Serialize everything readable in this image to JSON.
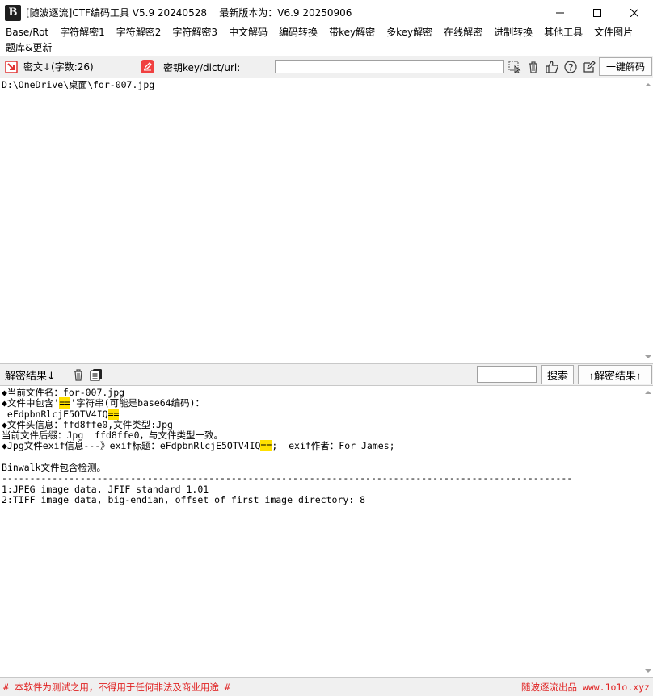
{
  "titlebar": {
    "logo_text": "B",
    "title": "[随波逐流]CTF编码工具 V5.9 20240528    最新版本为：V6.9 20250906"
  },
  "menu": {
    "row1": [
      "Base/Rot",
      "字符解密1",
      "字符解密2",
      "字符解密3",
      "中文解码",
      "编码转换",
      "带key解密",
      "多key解密",
      "在线解密",
      "进制转换",
      "其他工具",
      "文件图片"
    ],
    "row2": [
      "题库&更新"
    ]
  },
  "toolbar": {
    "cipher_label": "密文↓(字数:26)",
    "key_label": "密钥key/dict/url:",
    "key_value": "",
    "decode_button": "一键解码"
  },
  "input_pane": {
    "text": "D:\\OneDrive\\桌面\\for-007.jpg"
  },
  "result_bar": {
    "label": "解密结果↓",
    "search_value": "",
    "search_button": "搜索",
    "up_button": "↑解密结果↑"
  },
  "output_pane": {
    "lines": [
      [
        {
          "t": "◆当前文件名：for-007.jpg"
        }
      ],
      [
        {
          "t": "◆文件中包含'"
        },
        {
          "t": "==",
          "hl": true
        },
        {
          "t": "'字符串(可能是base64编码)："
        }
      ],
      [
        {
          "t": " eFdpbnRlcjE5OTV4IQ"
        },
        {
          "t": "==",
          "hl": true
        }
      ],
      [
        {
          "t": "◆文件头信息：ffd8ffe0,文件类型:Jpg"
        }
      ],
      [
        {
          "t": "当前文件后缀：Jpg  ffd8ffe0，与文件类型一致。"
        }
      ],
      [
        {
          "t": "◆Jpg文件exif信息---》exif标题：eFdpbnRlcjE5OTV4IQ"
        },
        {
          "t": "==",
          "hl": true
        },
        {
          "t": ";  exif作者：For James;"
        }
      ],
      [
        {
          "t": ""
        }
      ],
      [
        {
          "t": "Binwalk文件包含检测。"
        }
      ],
      [
        {
          "t": "------------------------------------------------------------------------------------------------------"
        }
      ],
      [
        {
          "t": "1:JPEG image data, JFIF standard 1.01"
        }
      ],
      [
        {
          "t": "2:TIFF image data, big-endian, offset of first image directory: 8"
        }
      ]
    ]
  },
  "footer": {
    "left": "# 本软件为测试之用，不得用于任何非法及商业用途 #",
    "right": "随波逐流出品 www.1o1o.xyz"
  },
  "colors": {
    "highlight": "#ffe000",
    "footer_text": "#e02020",
    "icon_red": "#e03030"
  },
  "icons": [
    "app-logo-icon",
    "minimize-icon",
    "maximize-icon",
    "close-icon",
    "paste-icon",
    "edit-icon",
    "copy-cursor-icon",
    "trash-icon",
    "thumbs-up-icon",
    "help-icon",
    "pencil-icon",
    "copy-icon"
  ]
}
